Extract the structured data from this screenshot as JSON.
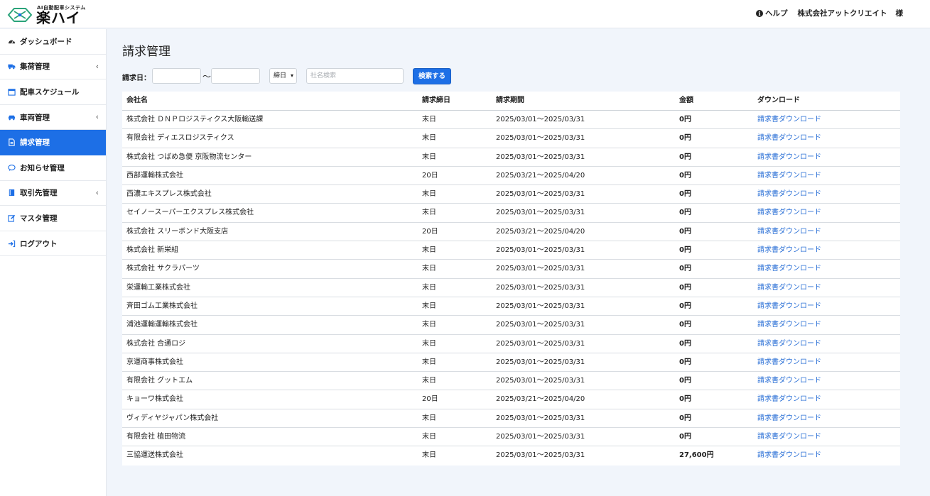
{
  "header": {
    "logo_sub": "AI自動配車システム",
    "logo_main": "楽ハイ",
    "help_label": "ヘルプ",
    "company": "株式会社アットクリエイト",
    "honorific": "様"
  },
  "sidebar": {
    "items": [
      {
        "label": "ダッシュボード",
        "icon": "dashboard-icon",
        "chevron": false
      },
      {
        "label": "集荷管理",
        "icon": "truck-icon",
        "chevron": true
      },
      {
        "label": "配車スケジュール",
        "icon": "calendar-icon",
        "chevron": false
      },
      {
        "label": "車両管理",
        "icon": "car-icon",
        "chevron": true
      },
      {
        "label": "請求管理",
        "icon": "document-icon",
        "chevron": false,
        "active": true
      },
      {
        "label": "お知らせ管理",
        "icon": "chat-icon",
        "chevron": false
      },
      {
        "label": "取引先管理",
        "icon": "book-icon",
        "chevron": true
      },
      {
        "label": "マスタ管理",
        "icon": "edit-icon",
        "chevron": false
      },
      {
        "label": "ログアウト",
        "icon": "logout-icon",
        "chevron": false
      }
    ],
    "chevron_glyph": "‹"
  },
  "main": {
    "title": "請求管理",
    "filters": {
      "date_label": "請求日：",
      "tilde": "〜",
      "closing_select": "締日",
      "search_placeholder": "社名検索",
      "search_button": "検索する"
    },
    "table": {
      "columns": [
        "会社名",
        "請求締日",
        "請求期間",
        "金額",
        "ダウンロード"
      ],
      "rows": [
        {
          "company": "株式会社 ＤＮＰロジスティクス大阪輸送課",
          "closing": "末日",
          "period": "2025/03/01〜2025/03/31",
          "amount": "0円",
          "download": "請求書ダウンロード"
        },
        {
          "company": "有限会社 ディエスロジスティクス",
          "closing": "末日",
          "period": "2025/03/01〜2025/03/31",
          "amount": "0円",
          "download": "請求書ダウンロード"
        },
        {
          "company": "株式会社 つばめ急便 京阪物流センター",
          "closing": "末日",
          "period": "2025/03/01〜2025/03/31",
          "amount": "0円",
          "download": "請求書ダウンロード"
        },
        {
          "company": "西部運輸株式会社",
          "closing": "20日",
          "period": "2025/03/21〜2025/04/20",
          "amount": "0円",
          "download": "請求書ダウンロード"
        },
        {
          "company": "西濃エキスプレス株式会社",
          "closing": "末日",
          "period": "2025/03/01〜2025/03/31",
          "amount": "0円",
          "download": "請求書ダウンロード"
        },
        {
          "company": "セイノースーパーエクスプレス株式会社",
          "closing": "末日",
          "period": "2025/03/01〜2025/03/31",
          "amount": "0円",
          "download": "請求書ダウンロード"
        },
        {
          "company": "株式会社 スリーボンド大阪支店",
          "closing": "20日",
          "period": "2025/03/21〜2025/04/20",
          "amount": "0円",
          "download": "請求書ダウンロード"
        },
        {
          "company": "株式会社 新栄組",
          "closing": "末日",
          "period": "2025/03/01〜2025/03/31",
          "amount": "0円",
          "download": "請求書ダウンロード"
        },
        {
          "company": "株式会社 サクラパーツ",
          "closing": "末日",
          "period": "2025/03/01〜2025/03/31",
          "amount": "0円",
          "download": "請求書ダウンロード"
        },
        {
          "company": "栄運輸工業株式会社",
          "closing": "末日",
          "period": "2025/03/01〜2025/03/31",
          "amount": "0円",
          "download": "請求書ダウンロード"
        },
        {
          "company": "斉田ゴム工業株式会社",
          "closing": "末日",
          "period": "2025/03/01〜2025/03/31",
          "amount": "0円",
          "download": "請求書ダウンロード"
        },
        {
          "company": "浦池運輸運輸株式会社",
          "closing": "末日",
          "period": "2025/03/01〜2025/03/31",
          "amount": "0円",
          "download": "請求書ダウンロード"
        },
        {
          "company": "株式会社 合通ロジ",
          "closing": "末日",
          "period": "2025/03/01〜2025/03/31",
          "amount": "0円",
          "download": "請求書ダウンロード"
        },
        {
          "company": "京運商事株式会社",
          "closing": "末日",
          "period": "2025/03/01〜2025/03/31",
          "amount": "0円",
          "download": "請求書ダウンロード"
        },
        {
          "company": "有限会社 グットエム",
          "closing": "末日",
          "period": "2025/03/01〜2025/03/31",
          "amount": "0円",
          "download": "請求書ダウンロード"
        },
        {
          "company": "キョーワ株式会社",
          "closing": "20日",
          "period": "2025/03/21〜2025/04/20",
          "amount": "0円",
          "download": "請求書ダウンロード"
        },
        {
          "company": "ヴィディヤジャパン株式会社",
          "closing": "末日",
          "period": "2025/03/01〜2025/03/31",
          "amount": "0円",
          "download": "請求書ダウンロード"
        },
        {
          "company": "有限会社 植田物流",
          "closing": "末日",
          "period": "2025/03/01〜2025/03/31",
          "amount": "0円",
          "download": "請求書ダウンロード"
        },
        {
          "company": "三協運送株式会社",
          "closing": "末日",
          "period": "2025/03/01〜2025/03/31",
          "amount": "27,600円",
          "download": "請求書ダウンロード"
        }
      ]
    }
  },
  "colors": {
    "accent": "#1d6fe6",
    "link": "#2a6fd6",
    "background": "#f1f5fb"
  }
}
